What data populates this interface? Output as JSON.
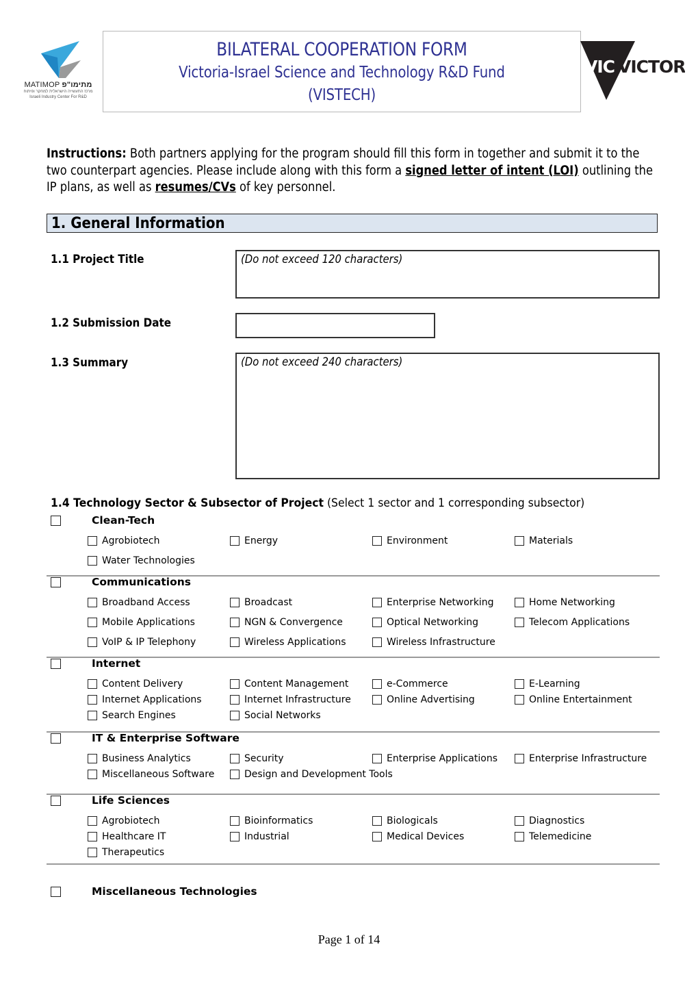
{
  "header": {
    "title": "BILATERAL COOPERATION FORM",
    "subtitle_line1": "Victoria-Israel Science and Technology R&D Fund",
    "subtitle_line2": "(VISTECH)",
    "title_color": "#2e3192",
    "left_logo": {
      "name": "MATIMOP",
      "hebrew": "מתימו\"פ",
      "hebrew_tagline": "מרכז התעשייה הישראלית למחקר ופיתוח",
      "tagline": "Israeli Industry Center For R&D"
    },
    "right_logo": {
      "name": "VICTORIA"
    }
  },
  "instructions": {
    "label": "Instructions:",
    "text_1": " Both partners applying for the program should fill this form in together and submit it to the two counterpart agencies. Please include along with this form a ",
    "link_1": "signed letter of intent (LOI)",
    "text_2": " outlining the IP plans, as well as ",
    "link_2": "resumes/CVs",
    "text_3": " of key personnel."
  },
  "section": {
    "title": "1.  General Information",
    "background": "#dce5f0"
  },
  "fields": {
    "project_title": {
      "label": "1.1  Project Title",
      "hint": "(Do not exceed 120 characters)",
      "value": ""
    },
    "submission_date": {
      "label": "1.2  Submission Date",
      "value": ""
    },
    "summary": {
      "label": "1.3  Summary",
      "hint": "(Do not exceed 240 characters)",
      "value": ""
    }
  },
  "sectors_heading": {
    "label": "1.4 Technology Sector & Subsector of Project",
    "note": " (Select 1 sector and 1 corresponding subsector)"
  },
  "sectors": [
    {
      "name": "Clean-Tech",
      "checked": false,
      "subsectors": [
        "Agrobiotech",
        "Energy",
        "Environment",
        "Materials",
        "Water Technologies"
      ]
    },
    {
      "name": "Communications",
      "checked": false,
      "subsectors": [
        "Broadband Access",
        "Broadcast",
        "Enterprise Networking",
        "Home Networking",
        "Mobile Applications",
        "NGN & Convergence",
        "Optical Networking",
        "Telecom Applications",
        "VoIP & IP Telephony",
        "Wireless Applications",
        "Wireless Infrastructure"
      ]
    },
    {
      "name": "Internet",
      "checked": false,
      "subsectors": [
        "Content Delivery",
        "Content Management",
        "e-Commerce",
        "E-Learning",
        "Internet Applications",
        "Internet Infrastructure",
        "Online Advertising",
        "Online Entertainment",
        "Search Engines",
        "Social Networks"
      ]
    },
    {
      "name": "IT & Enterprise Software",
      "checked": false,
      "subsectors": [
        "Business Analytics",
        "Security",
        "Enterprise Applications",
        "Enterprise Infrastructure",
        "Miscellaneous Software",
        "Design and Development Tools"
      ]
    },
    {
      "name": "Life Sciences",
      "checked": false,
      "subsectors": [
        "Agrobiotech",
        "Bioinformatics",
        "Biologicals",
        "Diagnostics",
        "Healthcare IT",
        "Industrial",
        "Medical Devices",
        "Telemedicine",
        "Therapeutics"
      ]
    },
    {
      "name": "Miscellaneous Technologies",
      "checked": false,
      "subsectors": []
    }
  ],
  "footer": {
    "page_label": "Page 1 of 14"
  }
}
